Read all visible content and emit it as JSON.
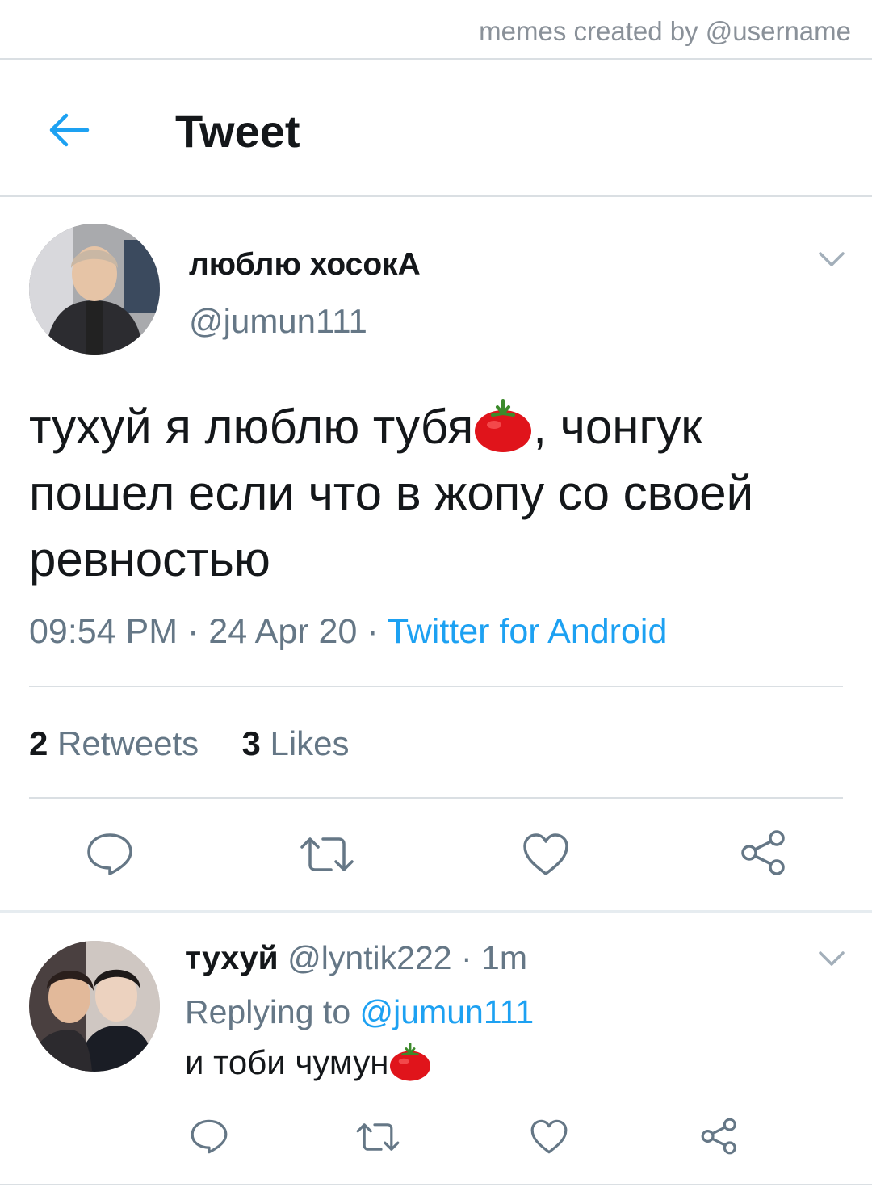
{
  "watermark": "memes created by @username",
  "header": {
    "title": "Tweet"
  },
  "tweet": {
    "display_name": "люблю хосокА",
    "handle": "@jumun111",
    "text_part1": "тухуй я люблю тубя",
    "text_part2": ", чонгук пошел если что в жопу со своей ревностью",
    "time": "09:54 PM",
    "date": "24 Apr 20",
    "source": "Twitter for Android",
    "retweets_count": "2",
    "retweets_label": "Retweets",
    "likes_count": "3",
    "likes_label": "Likes"
  },
  "reply_tweet": {
    "display_name": "тухуй",
    "handle": "@lyntik222",
    "age": "1m",
    "replying_prefix": "Replying to",
    "replying_handle": "@jumun111",
    "text": "и тоби чумун"
  },
  "colors": {
    "accent": "#1da1f2",
    "muted": "#657786",
    "divider": "#dadfe3"
  },
  "icons": [
    "back-arrow-icon",
    "chevron-down-icon",
    "reply-icon",
    "retweet-icon",
    "like-icon",
    "share-icon",
    "tomato-emoji"
  ]
}
